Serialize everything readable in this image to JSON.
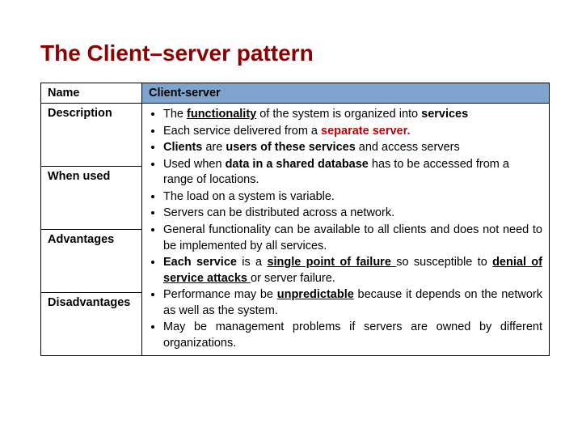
{
  "title": "The Client–server pattern",
  "labels": {
    "name": "Name",
    "desc": "Description",
    "when": "When used",
    "adv": "Advantages",
    "dis": "Disadvantages"
  },
  "name_value": "Client-server",
  "desc": {
    "b1a": "The ",
    "b1b": "functionality",
    "b1c": " of the system is organized into ",
    "b1d": "services",
    "b2a": "Each service delivered from a ",
    "b2b": "separate server.",
    "b3a": "Clients",
    "b3b": " are ",
    "b3c": "users of these services",
    "b3d": " and access servers"
  },
  "when": {
    "b1a": "Used when ",
    "b1b": "data in a shared database",
    "b1c": " has to be accessed from a range of locations.",
    "b2": "The load on a system is variable."
  },
  "adv": {
    "b1": "Servers can be distributed across a network.",
    "b2": "General functionality can be available to all clients and does not need to be implemented by all services."
  },
  "dis": {
    "b1a": "Each service",
    "b1b": " is a ",
    "b1c": "single point of failure ",
    "b1d": "so susceptible to ",
    "b1e": "denial of service attacks ",
    "b1f": "or server failure.",
    "b2a": "Performance may be ",
    "b2b": "unpredictable",
    "b2c": " because it depends on the network as well as the system.",
    "b3": "May be management problems if servers are owned by different organizations."
  }
}
